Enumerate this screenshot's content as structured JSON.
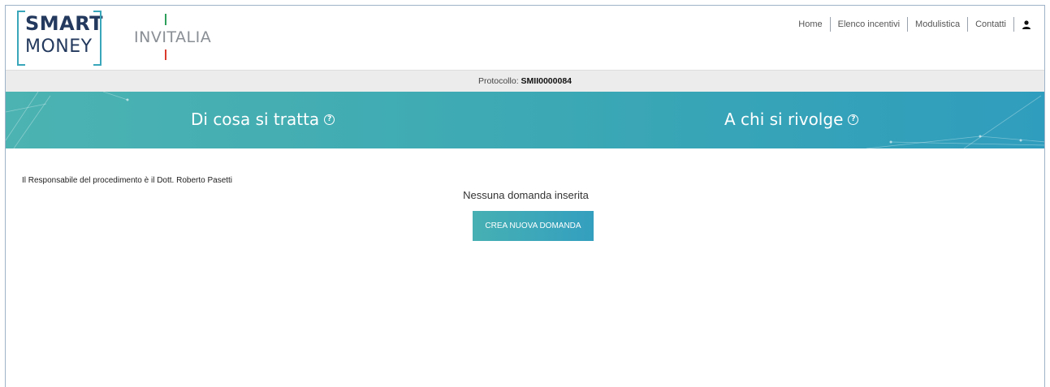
{
  "logo": {
    "smart_line1": "SMART",
    "smart_line2": "MONEY",
    "invitalia": "INVITALIA"
  },
  "nav": {
    "items": [
      "Home",
      "Elenco incentivi",
      "Modulistica",
      "Contatti"
    ],
    "user_icon": "user-icon"
  },
  "protocol": {
    "label": "Protocollo:",
    "value": "SMII0000084"
  },
  "band": {
    "tab1": "Di cosa si tratta",
    "tab2": "A chi si rivolge",
    "help_icon": "help-circle-icon",
    "color_start": "#4cb3b2",
    "color_end": "#2f9dbd"
  },
  "content": {
    "responsabile": "Il Responsabile del procedimento è il Dott. Roberto Pasetti",
    "empty_message": "Nessuna domanda inserita",
    "create_button": "CREA NUOVA DOMANDA"
  }
}
